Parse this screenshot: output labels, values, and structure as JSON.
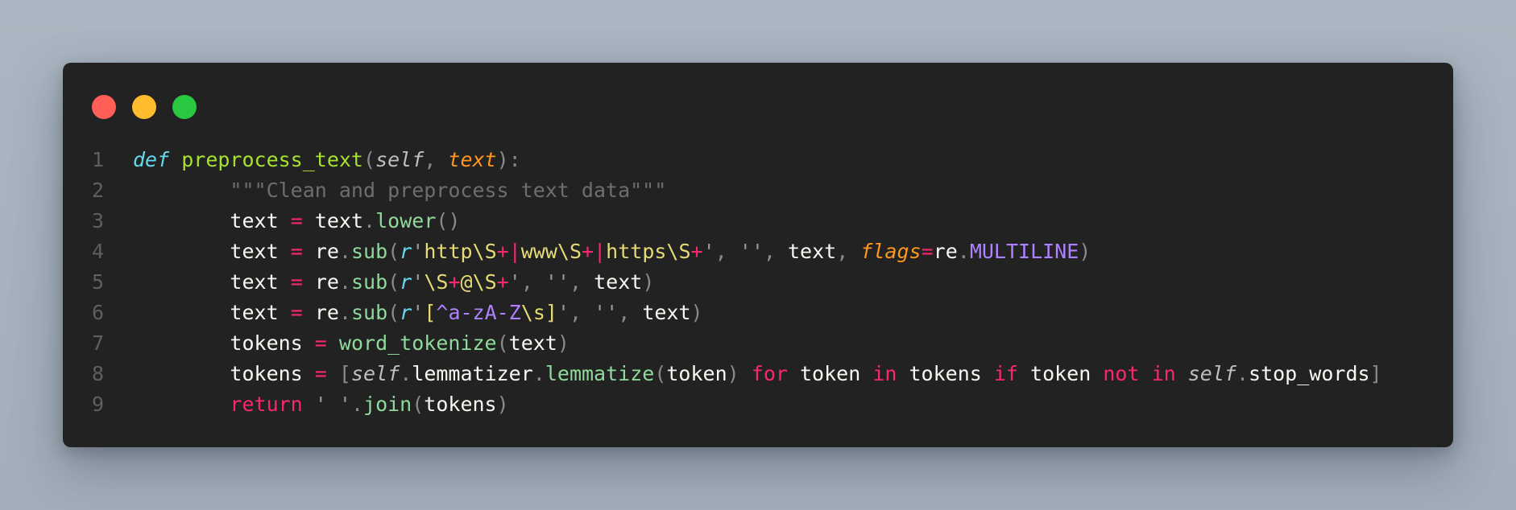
{
  "window": {
    "controls": [
      "close",
      "minimize",
      "maximize"
    ],
    "colors": {
      "close": "#ff5f57",
      "minimize": "#febc2e",
      "maximize": "#28c840",
      "background": "#222222"
    }
  },
  "code": {
    "language": "python",
    "lines": [
      {
        "n": "1",
        "tokens": [
          {
            "t": "def",
            "c": "kw-def"
          },
          {
            "t": " ",
            "c": "var"
          },
          {
            "t": "preprocess_text",
            "c": "fn"
          },
          {
            "t": "(",
            "c": "punc"
          },
          {
            "t": "self",
            "c": "self"
          },
          {
            "t": ", ",
            "c": "punc"
          },
          {
            "t": "text",
            "c": "param"
          },
          {
            "t": "):",
            "c": "punc"
          }
        ]
      },
      {
        "n": "2",
        "tokens": [
          {
            "t": "        ",
            "c": "var"
          },
          {
            "t": "\"\"\"Clean and preprocess text data\"\"\"",
            "c": "doc"
          }
        ]
      },
      {
        "n": "3",
        "tokens": [
          {
            "t": "        ",
            "c": "var"
          },
          {
            "t": "text",
            "c": "var"
          },
          {
            "t": " ",
            "c": "var"
          },
          {
            "t": "=",
            "c": "op"
          },
          {
            "t": " ",
            "c": "var"
          },
          {
            "t": "text",
            "c": "var"
          },
          {
            "t": ".",
            "c": "punc"
          },
          {
            "t": "lower",
            "c": "fn2"
          },
          {
            "t": "()",
            "c": "punc"
          }
        ]
      },
      {
        "n": "4",
        "tokens": [
          {
            "t": "        ",
            "c": "var"
          },
          {
            "t": "text",
            "c": "var"
          },
          {
            "t": " ",
            "c": "var"
          },
          {
            "t": "=",
            "c": "op"
          },
          {
            "t": " ",
            "c": "var"
          },
          {
            "t": "re",
            "c": "var"
          },
          {
            "t": ".",
            "c": "punc"
          },
          {
            "t": "sub",
            "c": "fn2"
          },
          {
            "t": "(",
            "c": "punc"
          },
          {
            "t": "r",
            "c": "rpref"
          },
          {
            "t": "'",
            "c": "strq"
          },
          {
            "t": "http\\S",
            "c": "str"
          },
          {
            "t": "+",
            "c": "regop"
          },
          {
            "t": "|",
            "c": "regop"
          },
          {
            "t": "www\\S",
            "c": "str"
          },
          {
            "t": "+",
            "c": "regop"
          },
          {
            "t": "|",
            "c": "regop"
          },
          {
            "t": "https\\S",
            "c": "str"
          },
          {
            "t": "+",
            "c": "regop"
          },
          {
            "t": "'",
            "c": "strq"
          },
          {
            "t": ", ",
            "c": "punc"
          },
          {
            "t": "''",
            "c": "strq"
          },
          {
            "t": ", ",
            "c": "punc"
          },
          {
            "t": "text",
            "c": "var"
          },
          {
            "t": ", ",
            "c": "punc"
          },
          {
            "t": "flags",
            "c": "kwarg"
          },
          {
            "t": "=",
            "c": "op"
          },
          {
            "t": "re",
            "c": "var"
          },
          {
            "t": ".",
            "c": "punc"
          },
          {
            "t": "MULTILINE",
            "c": "const"
          },
          {
            "t": ")",
            "c": "punc"
          }
        ]
      },
      {
        "n": "5",
        "tokens": [
          {
            "t": "        ",
            "c": "var"
          },
          {
            "t": "text",
            "c": "var"
          },
          {
            "t": " ",
            "c": "var"
          },
          {
            "t": "=",
            "c": "op"
          },
          {
            "t": " ",
            "c": "var"
          },
          {
            "t": "re",
            "c": "var"
          },
          {
            "t": ".",
            "c": "punc"
          },
          {
            "t": "sub",
            "c": "fn2"
          },
          {
            "t": "(",
            "c": "punc"
          },
          {
            "t": "r",
            "c": "rpref"
          },
          {
            "t": "'",
            "c": "strq"
          },
          {
            "t": "\\S",
            "c": "str"
          },
          {
            "t": "+",
            "c": "regop"
          },
          {
            "t": "@\\S",
            "c": "str"
          },
          {
            "t": "+",
            "c": "regop"
          },
          {
            "t": "'",
            "c": "strq"
          },
          {
            "t": ", ",
            "c": "punc"
          },
          {
            "t": "''",
            "c": "strq"
          },
          {
            "t": ", ",
            "c": "punc"
          },
          {
            "t": "text",
            "c": "var"
          },
          {
            "t": ")",
            "c": "punc"
          }
        ]
      },
      {
        "n": "6",
        "tokens": [
          {
            "t": "        ",
            "c": "var"
          },
          {
            "t": "text",
            "c": "var"
          },
          {
            "t": " ",
            "c": "var"
          },
          {
            "t": "=",
            "c": "op"
          },
          {
            "t": " ",
            "c": "var"
          },
          {
            "t": "re",
            "c": "var"
          },
          {
            "t": ".",
            "c": "punc"
          },
          {
            "t": "sub",
            "c": "fn2"
          },
          {
            "t": "(",
            "c": "punc"
          },
          {
            "t": "r",
            "c": "rpref"
          },
          {
            "t": "'",
            "c": "strq"
          },
          {
            "t": "[",
            "c": "str"
          },
          {
            "t": "^a-zA-Z",
            "c": "cls"
          },
          {
            "t": "\\s",
            "c": "str"
          },
          {
            "t": "]",
            "c": "str"
          },
          {
            "t": "'",
            "c": "strq"
          },
          {
            "t": ", ",
            "c": "punc"
          },
          {
            "t": "''",
            "c": "strq"
          },
          {
            "t": ", ",
            "c": "punc"
          },
          {
            "t": "text",
            "c": "var"
          },
          {
            "t": ")",
            "c": "punc"
          }
        ]
      },
      {
        "n": "7",
        "tokens": [
          {
            "t": "        ",
            "c": "var"
          },
          {
            "t": "tokens",
            "c": "var"
          },
          {
            "t": " ",
            "c": "var"
          },
          {
            "t": "=",
            "c": "op"
          },
          {
            "t": " ",
            "c": "var"
          },
          {
            "t": "word_tokenize",
            "c": "fn2"
          },
          {
            "t": "(",
            "c": "punc"
          },
          {
            "t": "text",
            "c": "var"
          },
          {
            "t": ")",
            "c": "punc"
          }
        ]
      },
      {
        "n": "8",
        "tokens": [
          {
            "t": "        ",
            "c": "var"
          },
          {
            "t": "tokens",
            "c": "var"
          },
          {
            "t": " ",
            "c": "var"
          },
          {
            "t": "=",
            "c": "op"
          },
          {
            "t": " ",
            "c": "var"
          },
          {
            "t": "[",
            "c": "punc"
          },
          {
            "t": "self",
            "c": "self"
          },
          {
            "t": ".",
            "c": "punc"
          },
          {
            "t": "lemmatizer",
            "c": "var"
          },
          {
            "t": ".",
            "c": "punc"
          },
          {
            "t": "lemmatize",
            "c": "fn2"
          },
          {
            "t": "(",
            "c": "punc"
          },
          {
            "t": "token",
            "c": "var"
          },
          {
            "t": ")",
            "c": "punc"
          },
          {
            "t": " ",
            "c": "var"
          },
          {
            "t": "for",
            "c": "kw"
          },
          {
            "t": " ",
            "c": "var"
          },
          {
            "t": "token",
            "c": "var"
          },
          {
            "t": " ",
            "c": "var"
          },
          {
            "t": "in",
            "c": "kw"
          },
          {
            "t": " ",
            "c": "var"
          },
          {
            "t": "tokens",
            "c": "var"
          },
          {
            "t": " ",
            "c": "var"
          },
          {
            "t": "if",
            "c": "kw"
          },
          {
            "t": " ",
            "c": "var"
          },
          {
            "t": "token",
            "c": "var"
          },
          {
            "t": " ",
            "c": "var"
          },
          {
            "t": "not",
            "c": "kw"
          },
          {
            "t": " ",
            "c": "var"
          },
          {
            "t": "in",
            "c": "kw"
          },
          {
            "t": " ",
            "c": "var"
          },
          {
            "t": "self",
            "c": "self"
          },
          {
            "t": ".",
            "c": "punc"
          },
          {
            "t": "stop_words",
            "c": "var"
          },
          {
            "t": "]",
            "c": "punc"
          }
        ]
      },
      {
        "n": "9",
        "tokens": [
          {
            "t": "        ",
            "c": "var"
          },
          {
            "t": "return",
            "c": "kw"
          },
          {
            "t": " ",
            "c": "var"
          },
          {
            "t": "' '",
            "c": "strq"
          },
          {
            "t": ".",
            "c": "punc"
          },
          {
            "t": "join",
            "c": "fn2"
          },
          {
            "t": "(",
            "c": "punc"
          },
          {
            "t": "tokens",
            "c": "var"
          },
          {
            "t": ")",
            "c": "punc"
          }
        ]
      }
    ]
  }
}
